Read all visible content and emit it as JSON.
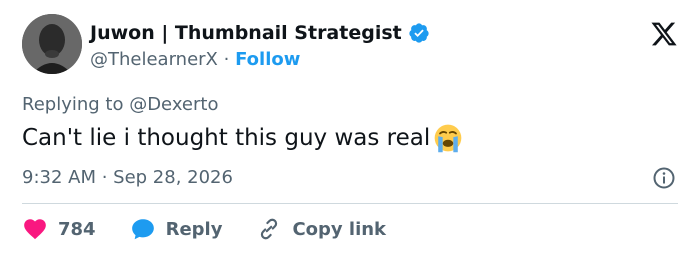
{
  "author": {
    "name": "Juwon | Thumbnail Strategist",
    "handle": "@ThelearnerX",
    "separator": "·",
    "follow_label": "Follow"
  },
  "tweet": {
    "replying_to": "Replying to @Dexerto",
    "text": "Can't lie i thought this guy was real",
    "emoji": "loudly-crying-face",
    "time": "9:32 AM · Sep 28, 2026"
  },
  "actions": {
    "like_count": "784",
    "reply_label": "Reply",
    "copy_label": "Copy link"
  },
  "colors": {
    "accent": "#1d9bf0",
    "like": "#f91880",
    "muted": "#536471",
    "text": "#0f1419"
  },
  "icons": [
    "verified-badge-icon",
    "x-logo-icon",
    "info-icon",
    "heart-icon",
    "reply-bubble-icon",
    "link-icon"
  ]
}
